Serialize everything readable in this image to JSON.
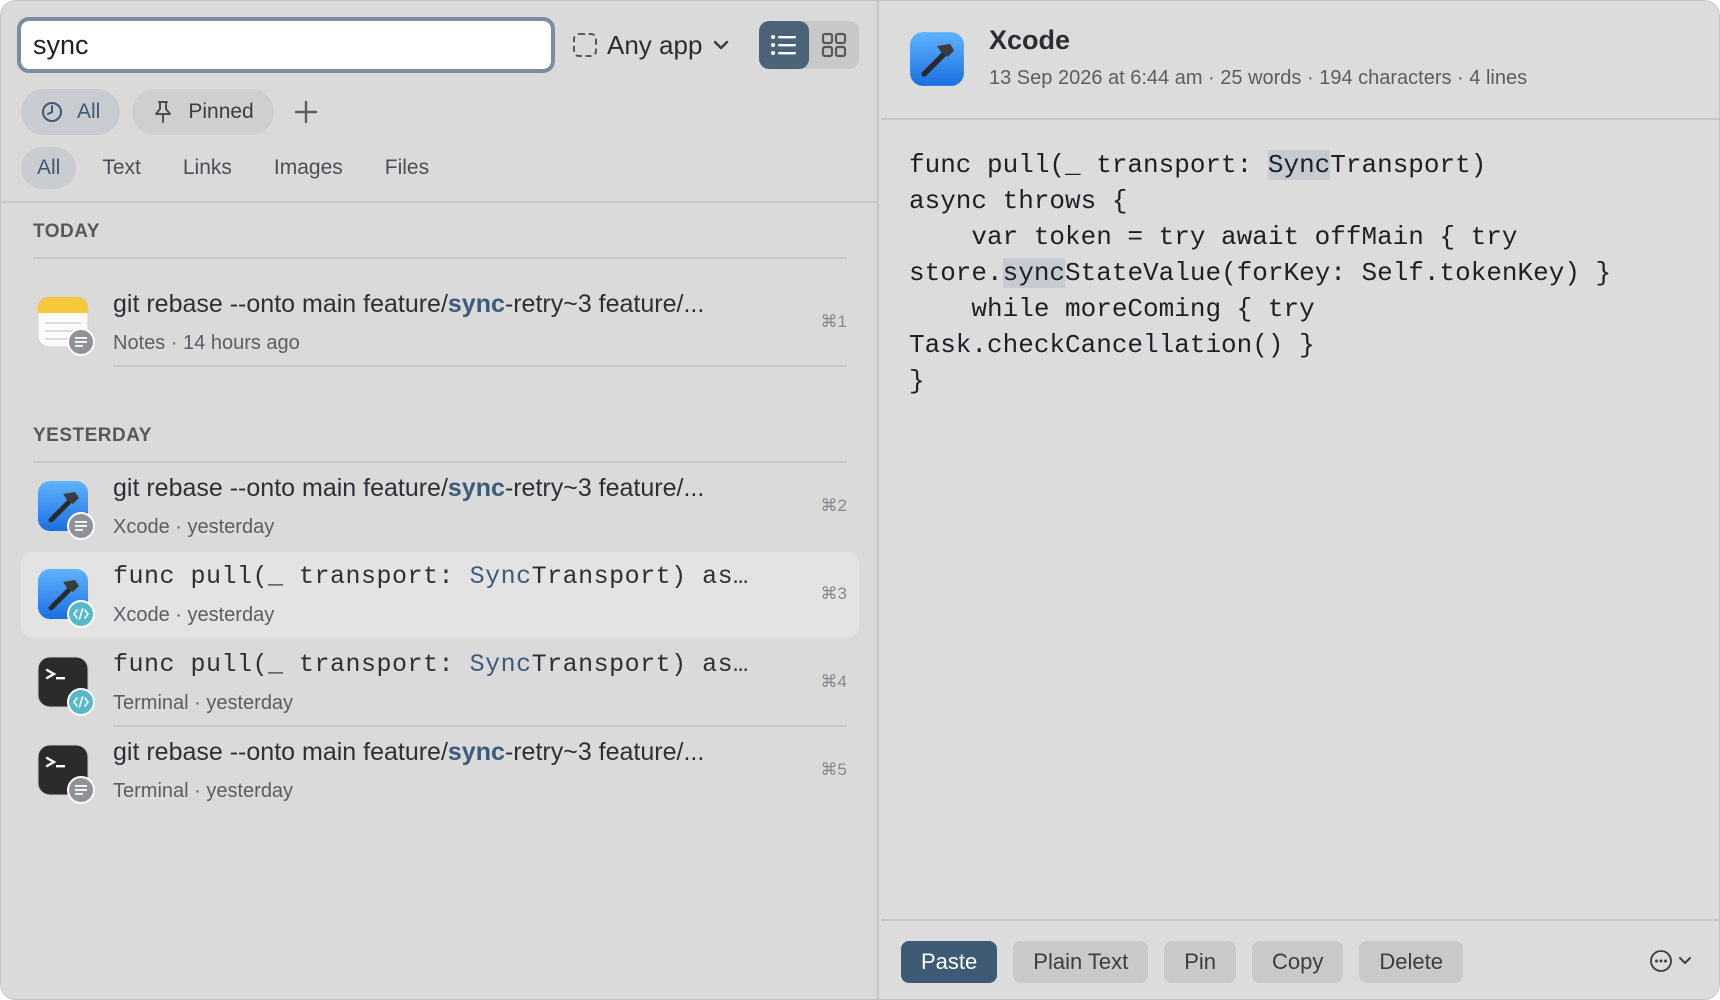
{
  "search": {
    "value": "sync",
    "placeholder": ""
  },
  "app_filter": {
    "label": "Any app",
    "icon": "dashed-square-icon"
  },
  "view_modes": [
    "list",
    "grid"
  ],
  "scope": {
    "all_label": "All",
    "pinned_label": "Pinned"
  },
  "type_tabs": [
    "All",
    "Text",
    "Links",
    "Images",
    "Files"
  ],
  "sections": {
    "today": "TODAY",
    "yesterday": "YESTERDAY"
  },
  "items": [
    {
      "title_pre": "git rebase --onto main feature/",
      "title_hl": "sync",
      "title_post": "-retry~3 feature/...",
      "app": "Notes",
      "time": "14 hours ago",
      "meta": "Notes · 14 hours ago",
      "shortcut": "⌘1",
      "kind": "text"
    },
    {
      "title_pre": "git rebase --onto main feature/",
      "title_hl": "sync",
      "title_post": "-retry~3 feature/...",
      "app": "Xcode",
      "time": "yesterday",
      "meta": "Xcode · yesterday",
      "shortcut": "⌘2",
      "kind": "text"
    },
    {
      "title_pre": "func pull(_ transport: ",
      "title_hl": "Sync",
      "title_post": "Transport) as…",
      "app": "Xcode",
      "time": "yesterday",
      "meta": "Xcode · yesterday",
      "shortcut": "⌘3",
      "kind": "code"
    },
    {
      "title_pre": "func pull(_ transport: ",
      "title_hl": "Sync",
      "title_post": "Transport) as…",
      "app": "Terminal",
      "time": "yesterday",
      "meta": "Terminal · yesterday",
      "shortcut": "⌘4",
      "kind": "code"
    },
    {
      "title_pre": "git rebase --onto main feature/",
      "title_hl": "sync",
      "title_post": "-retry~3 feature/...",
      "app": "Terminal",
      "time": "yesterday",
      "meta": "Terminal · yesterday",
      "shortcut": "⌘5",
      "kind": "text"
    }
  ],
  "detail": {
    "app": "Xcode",
    "meta": "13 Sep 2026 at 6:44 am · 25 words · 194 characters · 4 lines",
    "code": {
      "l1_pre": "func pull(_ transport: ",
      "l1_hl": "Sync",
      "l1_post": "Transport)",
      "l2": "async throws {",
      "l3": "    var token = try await offMain { try",
      "l4_pre": "store.",
      "l4_hl": "sync",
      "l4_post": "StateValue(forKey: Self.tokenKey) }",
      "l5": "    while moreComing { try",
      "l6": "Task.checkCancellation() }",
      "l7": "}"
    }
  },
  "actions": {
    "paste": "Paste",
    "plain_text": "Plain Text",
    "pin": "Pin",
    "copy": "Copy",
    "delete": "Delete"
  },
  "colors": {
    "accent": "#3e5a74",
    "highlight": "#3d5b7a",
    "code_badge": "#55b9c7"
  }
}
